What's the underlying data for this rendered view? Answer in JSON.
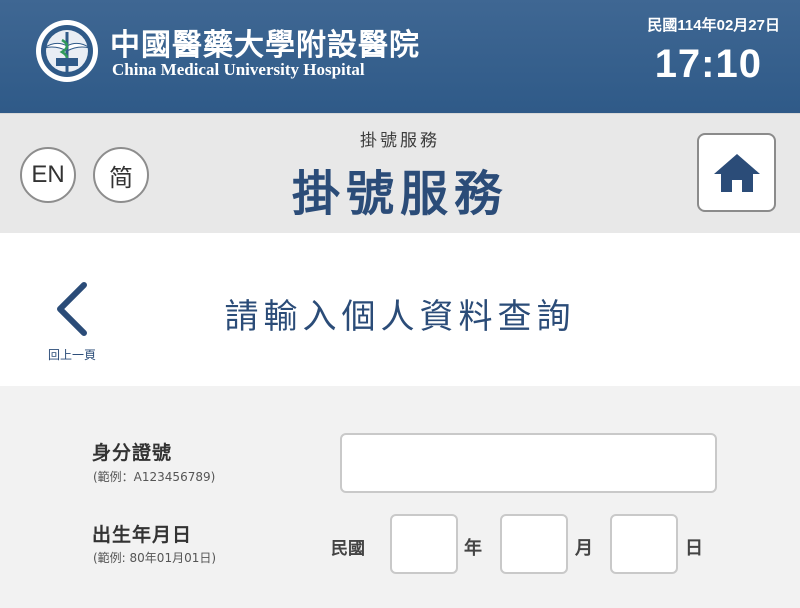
{
  "header": {
    "hospital_name_zh": "中國醫藥大學附設醫院",
    "hospital_name_en": "China Medical University Hospital",
    "date": "民國114年02月27日",
    "time": "17:10"
  },
  "service_bar": {
    "lang_en": "EN",
    "lang_simplified": "简",
    "subtitle": "掛號服務",
    "title": "掛號服務",
    "home_icon": "home-icon"
  },
  "nav": {
    "back_label": "回上一頁",
    "back_icon": "chevron-left-icon",
    "heading": "請輸入個人資料查詢"
  },
  "form": {
    "id_label": "身分證號",
    "id_hint": "(範例：A123456789)",
    "id_value": "",
    "dob_label": "出生年月日",
    "dob_hint": "(範例: 80年01月01日)",
    "era": "民國",
    "year_unit": "年",
    "month_unit": "月",
    "day_unit": "日",
    "year_value": "",
    "month_value": "",
    "day_value": ""
  },
  "colors": {
    "header_bg": "#2f5a88",
    "accent_navy": "#2b4c78",
    "service_bar_bg": "#e8e8e8",
    "form_bg": "#f2f2f2"
  }
}
